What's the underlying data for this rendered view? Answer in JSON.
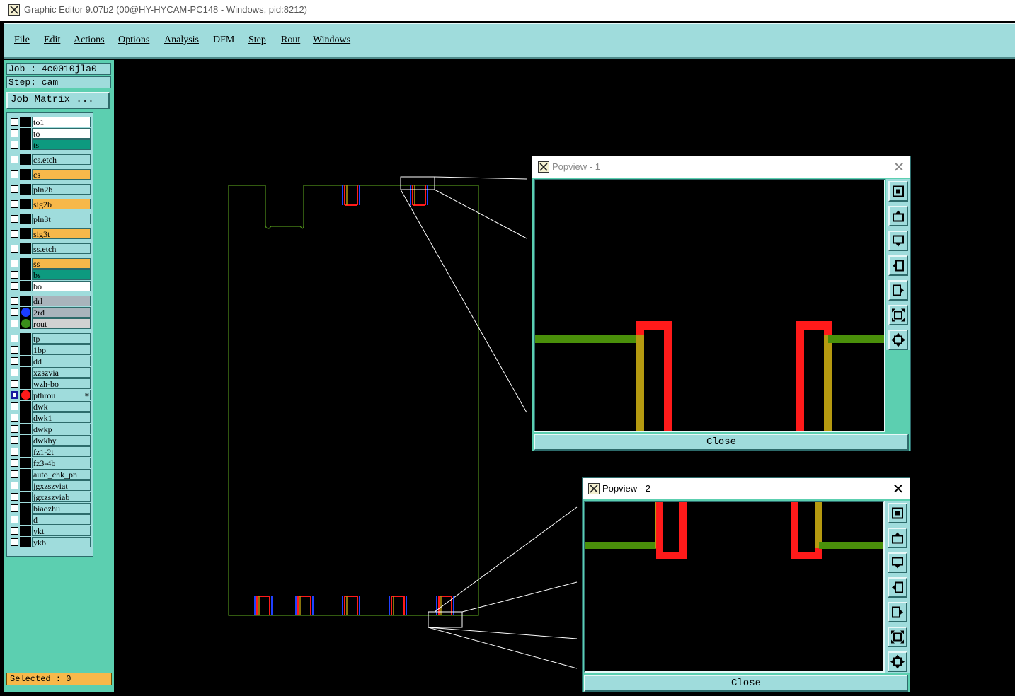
{
  "window": {
    "title": "Graphic Editor 9.07b2 (00@HY-HYCAM-PC148 - Windows, pid:8212)",
    "icon": "x-window-icon"
  },
  "menu": [
    "File",
    "Edit",
    "Actions",
    "Options",
    "Analysis",
    "DFM",
    "Step",
    "Rout",
    "Windows"
  ],
  "job": {
    "job_label": "Job : 4c0010jla0",
    "step_label": "Step: cam",
    "job_matrix_label": "Job Matrix ..."
  },
  "layers": [
    {
      "name": "to1",
      "color": "#ffffff"
    },
    {
      "name": "to",
      "color": "#ffffff"
    },
    {
      "name": "ts",
      "color": "#0d9a7f"
    },
    {
      "name": "cs.etch",
      "color": "#9fdcdc"
    },
    {
      "name": "cs",
      "color": "#f7b84a"
    },
    {
      "name": "pln2b",
      "color": "#9fdcdc"
    },
    {
      "name": "sig2b",
      "color": "#f7b84a"
    },
    {
      "name": "pln3t",
      "color": "#9fdcdc"
    },
    {
      "name": "sig3t",
      "color": "#f7b84a"
    },
    {
      "name": "ss.etch",
      "color": "#9fdcdc"
    },
    {
      "name": "ss",
      "color": "#f7b84a"
    },
    {
      "name": "bs",
      "color": "#0d9a7f"
    },
    {
      "name": "bo",
      "color": "#ffffff"
    },
    {
      "name": "drl",
      "color": "#a9b4bc"
    },
    {
      "name": "2rd",
      "color": "#a9b4bc",
      "indicator": "#1a3cff"
    },
    {
      "name": "rout",
      "color": "#d2d2d2",
      "indicator": "#3a8f1a"
    },
    {
      "name": "tp",
      "color": "#9fdcdc"
    },
    {
      "name": "1bp",
      "color": "#9fdcdc"
    },
    {
      "name": "dd",
      "color": "#9fdcdc"
    },
    {
      "name": "xzszvia",
      "color": "#9fdcdc"
    },
    {
      "name": "wzh-bo",
      "color": "#9fdcdc"
    },
    {
      "name": "pthrou",
      "color": "#9fdcdc",
      "indicator": "#ff1a1a",
      "active": true
    },
    {
      "name": "dwk",
      "color": "#9fdcdc"
    },
    {
      "name": "dwk1",
      "color": "#9fdcdc"
    },
    {
      "name": "dwkp",
      "color": "#9fdcdc"
    },
    {
      "name": "dwkby",
      "color": "#9fdcdc"
    },
    {
      "name": "fz1-2t",
      "color": "#9fdcdc"
    },
    {
      "name": "fz3-4b",
      "color": "#9fdcdc"
    },
    {
      "name": "auto_chk_pn",
      "color": "#9fdcdc"
    },
    {
      "name": "jgxzszviat",
      "color": "#9fdcdc"
    },
    {
      "name": "jgxzszviab",
      "color": "#9fdcdc"
    },
    {
      "name": "biaozhu",
      "color": "#9fdcdc"
    },
    {
      "name": "d",
      "color": "#9fdcdc"
    },
    {
      "name": "ykt",
      "color": "#9fdcdc"
    },
    {
      "name": "ykb",
      "color": "#9fdcdc"
    }
  ],
  "status": {
    "selected_label": "Selected : 0"
  },
  "popviews": [
    {
      "title": "Popview - 1",
      "close_label": "Close"
    },
    {
      "title": "Popview - 2",
      "close_label": "Close"
    }
  ],
  "popview_tools": [
    "zoom-fit-icon",
    "pan-up-icon",
    "pan-down-icon",
    "pan-left-icon",
    "pan-right-icon",
    "zoom-out-icon",
    "zoom-in-icon"
  ],
  "colors": {
    "panel": "#5ccfb0",
    "menubar": "#9fdcdc",
    "board_outline": "#5a9a2a",
    "trace_red": "#ff1a1a",
    "trace_green": "#4a8f0a",
    "trace_olive": "#b59a10"
  }
}
